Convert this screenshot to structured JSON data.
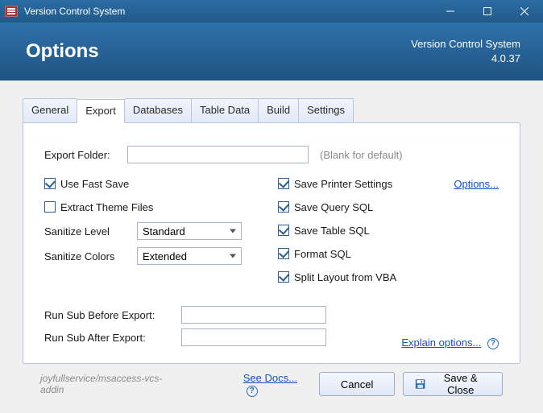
{
  "window": {
    "title": "Version Control System"
  },
  "header": {
    "title": "Options",
    "product": "Version Control System",
    "version": "4.0.37"
  },
  "tabs": [
    "General",
    "Export",
    "Databases",
    "Table Data",
    "Build",
    "Settings"
  ],
  "active_tab_index": 1,
  "export": {
    "folder_label": "Export Folder:",
    "folder_value": "",
    "folder_hint": "(Blank for default)",
    "left": {
      "use_fast_save": {
        "label": "Use Fast Save",
        "checked": true
      },
      "extract_theme": {
        "label": "Extract Theme Files",
        "checked": false
      },
      "sanitize_level": {
        "label": "Sanitize Level",
        "value": "Standard"
      },
      "sanitize_colors": {
        "label": "Sanitize Colors",
        "value": "Extended"
      }
    },
    "right": {
      "save_printer": {
        "label": "Save Printer Settings",
        "checked": true
      },
      "save_query_sql": {
        "label": "Save Query SQL",
        "checked": true
      },
      "save_table_sql": {
        "label": "Save Table SQL",
        "checked": true
      },
      "format_sql": {
        "label": "Format SQL",
        "checked": true
      },
      "split_layout_vba": {
        "label": "Split Layout from VBA",
        "checked": true
      },
      "options_link": "Options..."
    },
    "run_before_label": "Run Sub Before Export:",
    "run_before_value": "",
    "run_after_label": "Run Sub After Export:",
    "run_after_value": "",
    "explain_link": "Explain options..."
  },
  "footer": {
    "repo": "joyfullservice/msaccess-vcs-addin",
    "docs_link": "See Docs...",
    "cancel": "Cancel",
    "save_close": "Save & Close"
  }
}
